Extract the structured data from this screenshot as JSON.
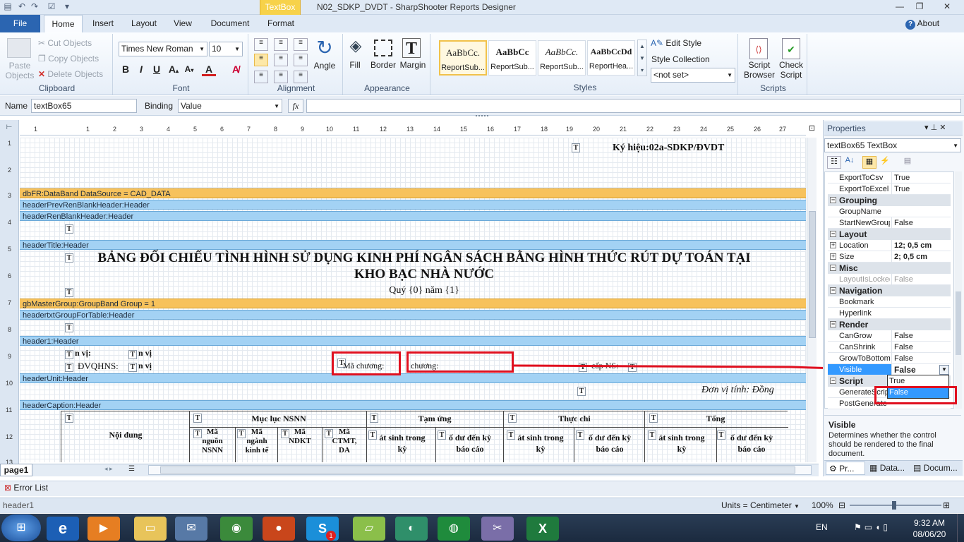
{
  "titlebar": {
    "context_tab": "TextBox",
    "title": "N02_SDKP_DVDT - SharpShooter Reports Designer"
  },
  "tabs": [
    "File",
    "Home",
    "Insert",
    "Layout",
    "View",
    "Document",
    "Format"
  ],
  "about": "About",
  "ribbon": {
    "clipboard": {
      "label": "Clipboard",
      "paste": "Paste\nObjects",
      "cut": "Cut Objects",
      "copy": "Copy Objects",
      "delete": "Delete Objects"
    },
    "font": {
      "label": "Font",
      "family": "Times New Roman",
      "size": "10"
    },
    "alignment": {
      "label": "Alignment",
      "angle": "Angle"
    },
    "appearance": {
      "label": "Appearance",
      "fill": "Fill",
      "border": "Border",
      "margin": "Margin"
    },
    "styles": {
      "label": "Styles",
      "items": [
        {
          "preview": "AaBbCc.",
          "name": "ReportSub..."
        },
        {
          "preview": "AaBbCc",
          "name": "ReportSub..."
        },
        {
          "preview": "AaBbCc.",
          "name": "ReportSub..."
        },
        {
          "preview": "AaBbCcDd",
          "name": "ReportHea..."
        }
      ],
      "edit": "Edit Style",
      "collection": "Style Collection",
      "select": "<not set>"
    },
    "scripts": {
      "label": "Scripts",
      "browser": "Script\nBrowser",
      "check": "Check\nScript"
    }
  },
  "namebar": {
    "name_label": "Name",
    "name_value": "textBox65",
    "binding_label": "Binding",
    "binding_value": "Value",
    "fx": "fx"
  },
  "vruler": [
    "1",
    "2",
    "3",
    "4",
    "5",
    "6",
    "7",
    "8",
    "9",
    "10",
    "11",
    "12",
    "13"
  ],
  "hruler": [
    "1",
    "1",
    "2",
    "3",
    "4",
    "5",
    "6",
    "7",
    "8",
    "9",
    "10",
    "11",
    "12",
    "13",
    "14",
    "15",
    "16",
    "17",
    "18",
    "19",
    "20",
    "21",
    "22",
    "23",
    "24",
    "25",
    "26",
    "27"
  ],
  "report": {
    "kyhieu": "Ký hiệu:02a-SDKP/ĐVDT",
    "bands": {
      "databand": "dbFR:DataBand  DataSource = CAD_DATA",
      "prev": "headerPrevRenBlankHeader:Header",
      "ren": "headerRenBlankHeader:Header",
      "title": "headerTitle:Header",
      "group": "gbMasterGroup:GroupBand  Group = 1",
      "txtgroup": "headertxtGroupForTable:Header",
      "header1": "header1:Header",
      "unit": "headerUnit:Header",
      "caption": "headerCaption:Header"
    },
    "title_line1": "BẢNG ĐỐI CHIẾU TÌNH HÌNH SỬ DỤNG KINH PHÍ NGÂN SÁCH BẰNG HÌNH THỨC RÚT DỰ TOÁN TẠI",
    "title_line2": "KHO BẠC NHÀ NƯỚC",
    "title_line3": "Quý {0} năm {1}",
    "donvi": "n vị:",
    "donvi2": "n vị",
    "dvqhns": "ĐVQHNS:",
    "dvqhns2": "n vị",
    "machuong": "Mã chương:",
    "chuong": "chương:",
    "capns": "cấp NS:",
    "unit": "Đơn vị tính: Đồng",
    "caption": {
      "noidung": "Nội dung",
      "mucluc": "Mục lục NSNN",
      "tamung": "Tạm ứng",
      "thucchi": "Thực chi",
      "tong": "Tổng",
      "manguon": "Mã\nnguồn\nNSNN",
      "manganh": "Mã\nngành\nkinh tế",
      "mandkt": "Mã\nNDKT",
      "mactmt": "Mã\nCTMT,\nDA",
      "phatsinh": "át sinh trong\nkỳ",
      "soduden": "ố dư đến kỳ\nbáo cáo"
    }
  },
  "page_tab": "page1",
  "error_list": "Error List",
  "status": {
    "left": "header1",
    "units": "Units = Centimeter",
    "zoom": "100%"
  },
  "properties": {
    "title": "Properties",
    "object": "textBox65 TextBox",
    "rows": [
      {
        "type": "prop",
        "name": "ExportToCsv",
        "value": "True"
      },
      {
        "type": "prop",
        "name": "ExportToExcel",
        "value": "True"
      },
      {
        "type": "cat",
        "name": "Grouping"
      },
      {
        "type": "prop",
        "name": "GroupName",
        "value": ""
      },
      {
        "type": "prop",
        "name": "StartNewGroup",
        "value": "False"
      },
      {
        "type": "cat",
        "name": "Layout"
      },
      {
        "type": "propx",
        "name": "Location",
        "value": "12; 0,5 cm"
      },
      {
        "type": "propx",
        "name": "Size",
        "value": "2; 0,5 cm"
      },
      {
        "type": "cat",
        "name": "Misc"
      },
      {
        "type": "prop",
        "name": "LayoutIsLocked",
        "value": "False"
      },
      {
        "type": "cat",
        "name": "Navigation"
      },
      {
        "type": "prop",
        "name": "Bookmark",
        "value": ""
      },
      {
        "type": "prop",
        "name": "Hyperlink",
        "value": ""
      },
      {
        "type": "cat",
        "name": "Render"
      },
      {
        "type": "prop",
        "name": "CanGrow",
        "value": "False"
      },
      {
        "type": "prop",
        "name": "CanShrink",
        "value": "False"
      },
      {
        "type": "prop",
        "name": "GrowToBottom",
        "value": "False"
      },
      {
        "type": "sel",
        "name": "Visible",
        "value": "False"
      },
      {
        "type": "cat",
        "name": "Script"
      },
      {
        "type": "prop",
        "name": "GenerateScript",
        "value": ""
      },
      {
        "type": "prop",
        "name": "PostGenerate",
        "value": ""
      }
    ],
    "dropdown": [
      "True",
      "False"
    ],
    "desc_title": "Visible",
    "desc_text": "Determines whether the control should be rendered to the final document.",
    "tabs": [
      "Pr...",
      "Data...",
      "Docum..."
    ]
  },
  "taskbar": {
    "lang": "EN",
    "time": "9:32 AM",
    "date": "08/06/20",
    "badge": "1"
  },
  "colors": {
    "accent": "#2b65b1",
    "band_orange": "#f7c25c",
    "band_blue": "#a3d2f4",
    "highlight_red": "#e0101f",
    "select_blue": "#3399ff"
  }
}
